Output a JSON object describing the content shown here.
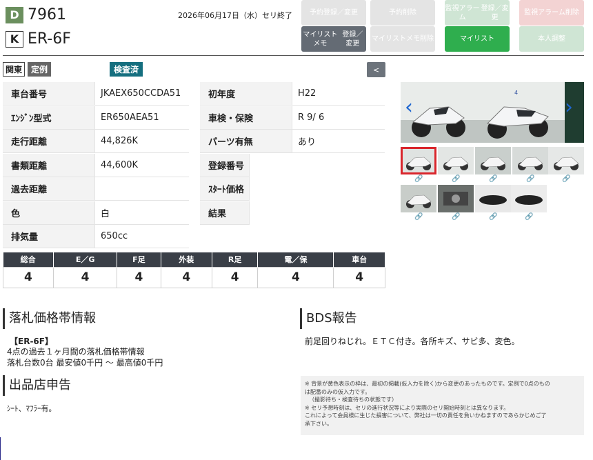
{
  "header": {
    "d_badge": "D",
    "lot_number": "7961",
    "k_badge": "K",
    "model": "ER-6F",
    "auction_date": "2026年06月17日（水）セリ終了",
    "buttons": [
      {
        "label1": "予約",
        "label2": "登録／変更",
        "color": "#e4e4e4",
        "text": "#ffffff"
      },
      {
        "label1": "予約削除",
        "label2": "",
        "color": "#e4e4e4",
        "text": "#ffffff"
      },
      {
        "label1": "監視アラーム",
        "label2": "登録／変更",
        "color": "#cfe5d4",
        "text": "#ffffff"
      },
      {
        "label1": "監視アラーム",
        "label2": "削除",
        "color": "#f3d3d3",
        "text": "#ffffff"
      },
      {
        "label1": "マイリストメモ",
        "label2": "登録／変更",
        "color": "#646b74",
        "text": "#ffffff"
      },
      {
        "label1": "マイリストメモ",
        "label2": "削除",
        "color": "#e4e4e4",
        "text": "#ffffff"
      },
      {
        "label1": "マイリスト",
        "label2": "",
        "color": "#2fae4e",
        "text": "#ffffff"
      },
      {
        "label1": "本人調整",
        "label2": "",
        "color": "#cfe5d4",
        "text": "#ffffff"
      }
    ]
  },
  "tags": {
    "region": "関東",
    "type": "定例",
    "inspected": "検査済",
    "back_button": "<"
  },
  "specs_left": [
    {
      "key": "車台番号",
      "value": "JKAEX650CCDA51"
    },
    {
      "key": "ｴﾝｼﾞﾝ型式",
      "value": "ER650AEA51"
    },
    {
      "key": "走行距離",
      "value": "44,826K"
    },
    {
      "key": "書類距離",
      "value": "44,600K"
    },
    {
      "key": "過去距離",
      "value": ""
    },
    {
      "key": "色",
      "value": "白"
    },
    {
      "key": "排気量",
      "value": "650cc"
    }
  ],
  "specs_right": [
    {
      "key": "初年度",
      "value": "H22"
    },
    {
      "key": "車検・保険",
      "value": "R 9/ 6"
    },
    {
      "key": "パーツ有無",
      "value": "あり"
    },
    {
      "key": "登録番号",
      "value": ""
    },
    {
      "key": "ｽﾀｰﾄ価格",
      "value": ""
    },
    {
      "key": "結果",
      "value": ""
    }
  ],
  "scores": {
    "headers": [
      "総合",
      "E／G",
      "F足",
      "外装",
      "R足",
      "電／保",
      "車台"
    ],
    "values": [
      "4",
      "4",
      "4",
      "4",
      "4",
      "4",
      "4"
    ]
  },
  "gallery": {
    "main_number": "4",
    "prev_icon": "chevron-left-icon",
    "next_icon": "chevron-right-icon",
    "link_icon": "link-icon",
    "selected_color": "#d9262c"
  },
  "price_info": {
    "title": "落札価格帯情報",
    "model_tag": "【ER-6F】",
    "line1": "4点の過去１ヶ月間の落札価格帯情報",
    "line2": "落札台数0台 最安値0千円 ～ 最高値0千円"
  },
  "bds": {
    "title": "BDS報告",
    "text": "前足回りねじれ。ＥＴＣ付き。各所キズ、サビ多、変色。"
  },
  "seller": {
    "title": "出品店申告",
    "text": "ｼｰﾄ、ﾏﾌﾗｰ有。"
  },
  "notice": {
    "line1": "※ 背景が黄色表示の枠は、最初の掲載(仮入力を除く)から変更のあったものです。定例で0点のもの",
    "line2": "は配番のみの仮入力です。",
    "line3": "（撮影待ち・検査待ちの状態です）",
    "line4": "※ セリ予想時刻は、セリの進行状況等により実際のセリ開始時刻とは異なります。",
    "line5": "これによって会員様に生じた損害について、弊社は一切の責任を負いかねますのであらかじめご了",
    "line6": "承下さい。"
  }
}
